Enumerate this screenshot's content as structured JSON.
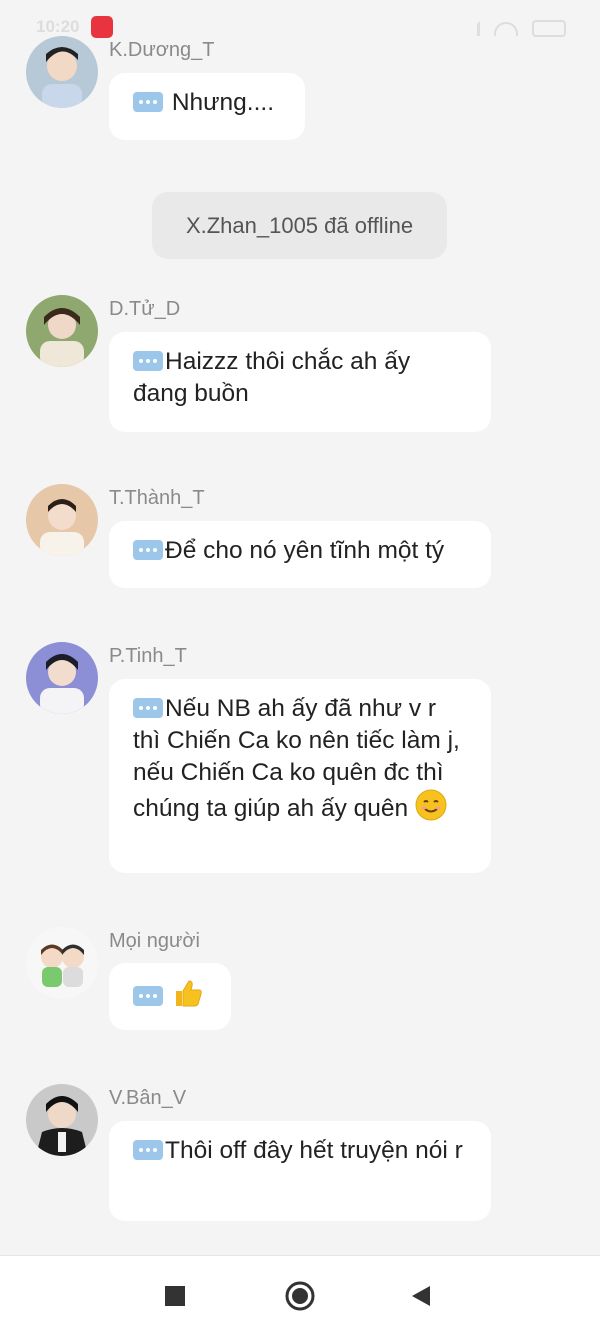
{
  "status_bar": {
    "time": "10:20",
    "app_icon": "mangatoon-icon"
  },
  "messages": [
    {
      "name": "K.Dương_T",
      "text": "Nhưng...."
    },
    {
      "name": "D.Tử_D",
      "text": "Haizzz thôi chắc ah ấy đang buồn"
    },
    {
      "name": "T.Thành_T",
      "text": "Để cho nó yên tĩnh một tý"
    },
    {
      "name": "P.Tinh_T",
      "text": "Nếu NB ah ấy đã như v r thì Chiến Ca ko nên tiếc làm j, nếu Chiến Ca ko quên đc thì chúng ta giúp ah ấy quên"
    },
    {
      "name": "Mọi người",
      "text": ""
    },
    {
      "name": "V.Bân_V",
      "text": "Thôi off đây hết truyện nói r"
    }
  ],
  "system_note": "X.Zhan_1005 đã offline",
  "emoji": {
    "smile": "smiling-face",
    "thumb": "thumbs-up"
  },
  "nav": {
    "recents": "square-icon",
    "home": "circle-icon",
    "back": "triangle-back-icon"
  }
}
